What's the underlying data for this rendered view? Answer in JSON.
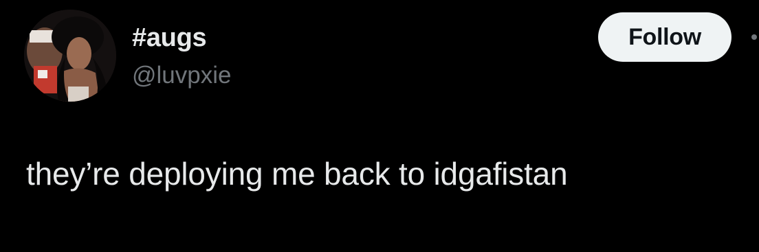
{
  "tweet": {
    "author": {
      "display_name": "#augs",
      "handle": "@luvpxie",
      "avatar_icon": "profile-photo"
    },
    "follow_label": "Follow",
    "more_icon": "more-options-icon",
    "text": "they’re deploying me back to idgafistan"
  },
  "colors": {
    "background": "#000000",
    "primary_text": "#e7e9ea",
    "secondary_text": "#71767b",
    "follow_button_bg": "#eff3f4",
    "follow_button_text": "#0f1419"
  }
}
